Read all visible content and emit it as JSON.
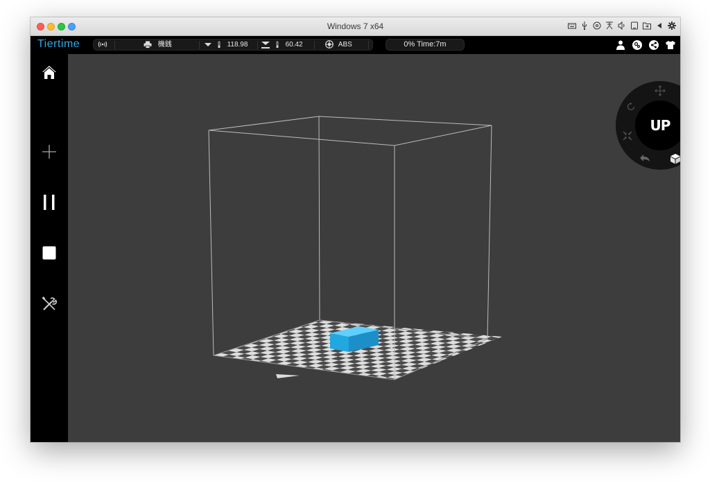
{
  "window": {
    "title": "Windows 7 x64"
  },
  "topbar": {
    "logo": "Tiertime",
    "printer_name": "機銭",
    "nozzle_temp": "118.98",
    "bed_temp": "60.42",
    "material": "ABS",
    "progress_text": "0%  Time:7m",
    "progress_fraction": 0.0
  },
  "radial_menu": {
    "center_label": "UP"
  },
  "colors": {
    "accent": "#2fa9e8",
    "model": "#2aaee6",
    "viewport_bg": "#3d3d3d"
  },
  "icons": {
    "sidebar": [
      "home-icon",
      "add-icon",
      "pause-icon",
      "stop-icon",
      "tools-icon"
    ],
    "topbar_right": [
      "user-icon",
      "settings-icon",
      "share-icon",
      "shirt-icon"
    ],
    "radial": [
      "move-icon",
      "rotate-icon",
      "scale-icon",
      "reset-icon",
      "layout-icon",
      "menu-icon",
      "undo-icon",
      "cube-icon"
    ]
  }
}
